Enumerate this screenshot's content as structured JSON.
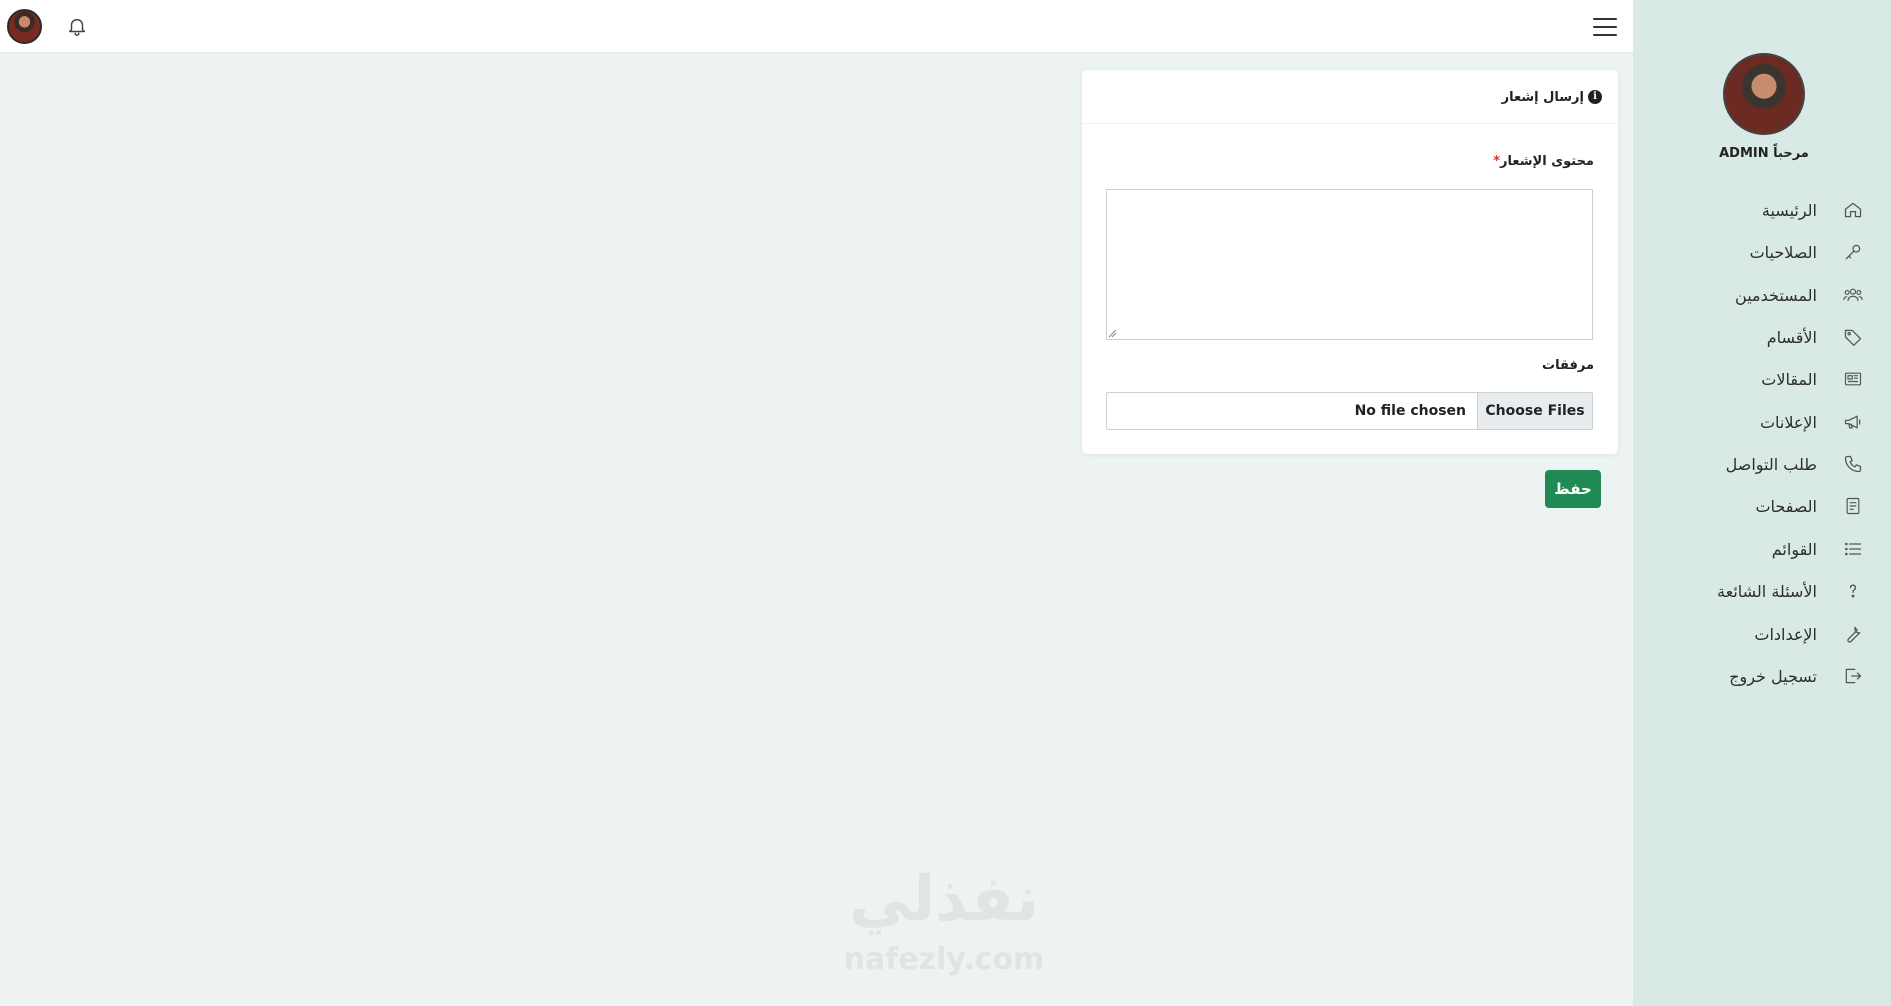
{
  "sidebar": {
    "welcome": "مرحباً ADMIN",
    "items": [
      {
        "label": "الرئيسية",
        "icon": "home-icon"
      },
      {
        "label": "الصلاحيات",
        "icon": "key-icon"
      },
      {
        "label": "المستخدمين",
        "icon": "users-icon"
      },
      {
        "label": "الأقسام",
        "icon": "tag-icon"
      },
      {
        "label": "المقالات",
        "icon": "newspaper-icon"
      },
      {
        "label": "الإعلانات",
        "icon": "megaphone-icon"
      },
      {
        "label": "طلب التواصل",
        "icon": "phone-icon"
      },
      {
        "label": "الصفحات",
        "icon": "page-icon"
      },
      {
        "label": "القوائم",
        "icon": "list-icon"
      },
      {
        "label": "الأسئلة الشائعة",
        "icon": "question-icon"
      },
      {
        "label": "الإعدادات",
        "icon": "wrench-icon"
      },
      {
        "label": "تسجيل خروج",
        "icon": "logout-icon"
      }
    ]
  },
  "card": {
    "title": "إرسال إشعار",
    "content_label": "محتوى الإشعار",
    "required_mark": "*",
    "content_value": "",
    "attachments_label": "مرفقات",
    "file_button": "Choose Files",
    "file_status": "No file chosen"
  },
  "save_button": "حفظ",
  "watermark": {
    "arabic": "نفذلي",
    "latin": "nafezly.com"
  },
  "colors": {
    "page_bg": "#edf3f2",
    "sidebar_bg": "#d9e9e5",
    "save_button": "#1f8a53",
    "required": "#d9312e"
  }
}
